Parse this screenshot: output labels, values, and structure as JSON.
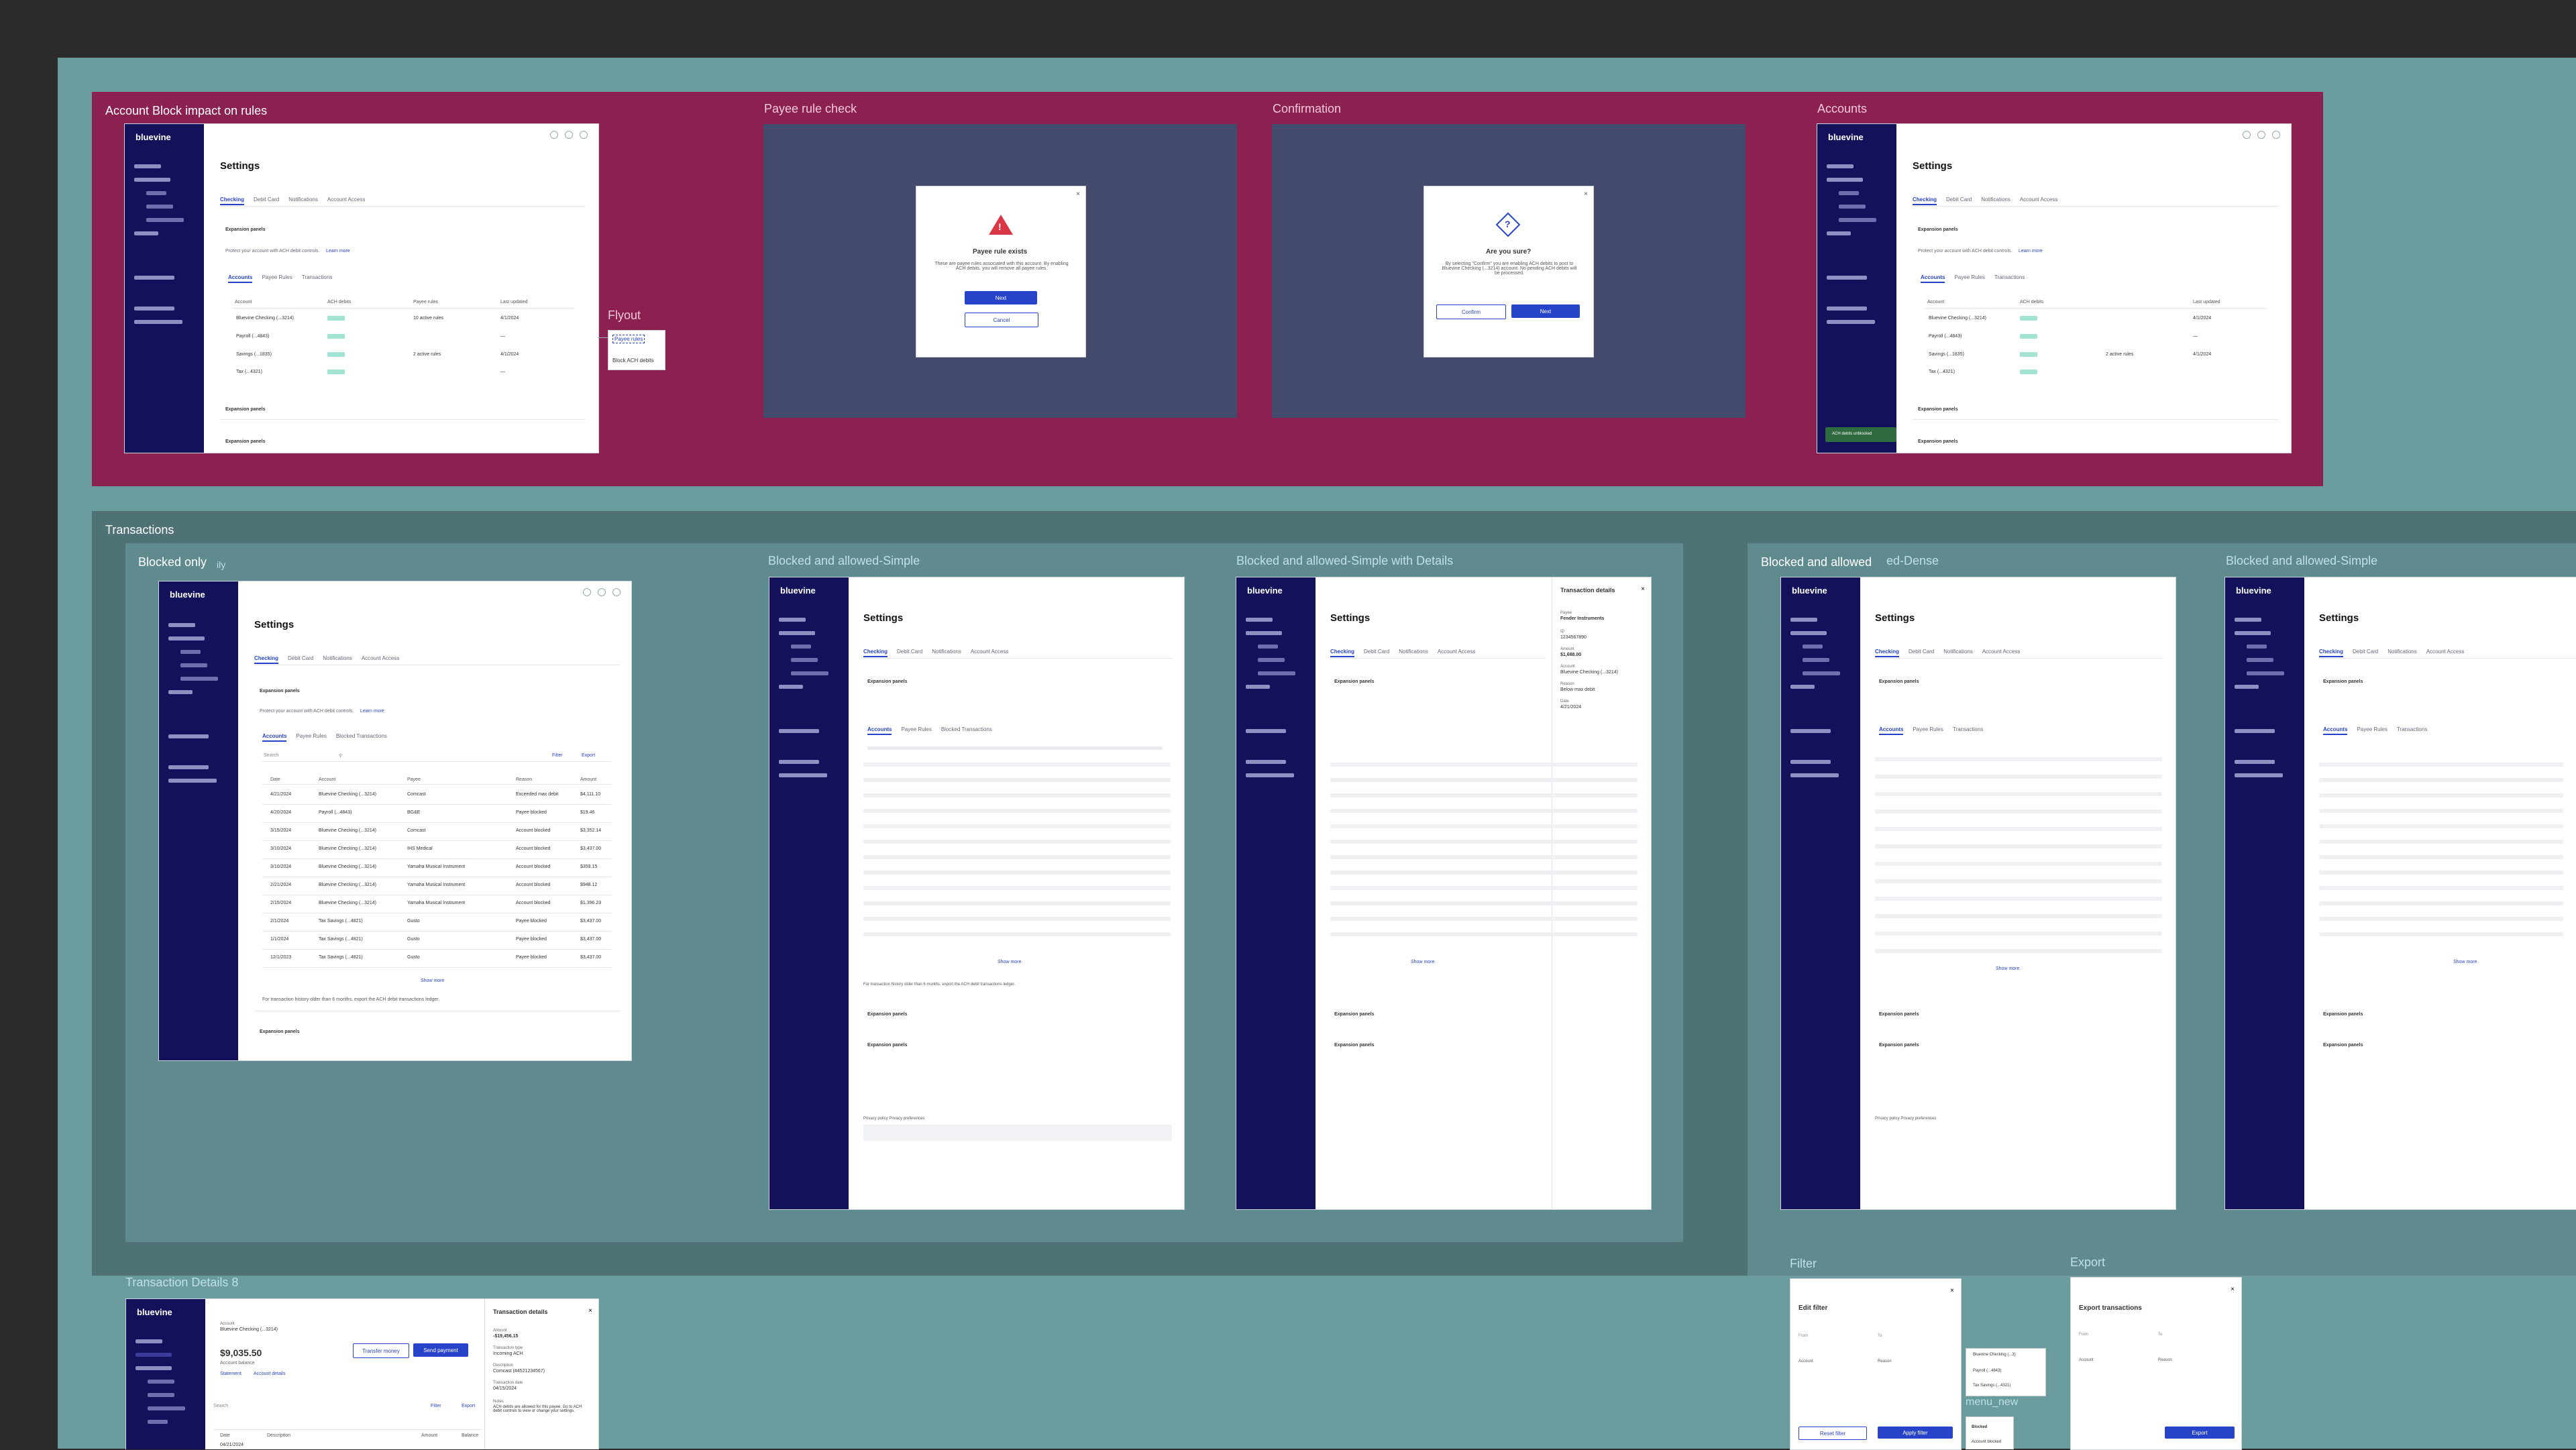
{
  "sections": {
    "account_block": "Account Block impact on rules",
    "payee_rule_check": "Payee rule check",
    "confirmation": "Confirmation",
    "accounts": "Accounts",
    "flyout": "Flyout",
    "transactions": "Transactions",
    "blocked_only": "Blocked only",
    "blocked_only_suffix": "ily",
    "blocked_allowed_simple": "Blocked and allowed-Simple",
    "blocked_allowed_simple_details": "Blocked and allowed-Simple with Details",
    "blocked_allowed": "Blocked and allowed",
    "blocked_allowed_suffix": "ed-Dense",
    "blocked_allowed_simple_2": "Blocked and allowed-Simple",
    "transaction_details_8": "Transaction Details 8",
    "filter": "Filter",
    "export": "Export",
    "menu_new": "menu_new"
  },
  "app": {
    "logo": "bluevine",
    "page_title": "Settings",
    "tabs": [
      "Checking",
      "Debit Card",
      "Notifications",
      "Account Access"
    ],
    "expansion_panels": "Expansion panels",
    "protect_text": "Protect your account with ACH debit controls.",
    "learn_more": "Learn more",
    "subtabs": [
      "Accounts",
      "Payee Rules",
      "Transactions"
    ],
    "subtabs_blocked": [
      "Accounts",
      "Payee Rules",
      "Blocked Transactions"
    ],
    "table_headers": [
      "Account",
      "ACH debits",
      "Payee rules",
      "Last updated"
    ],
    "accounts": [
      {
        "name": "Bluevine Checking (...3214)",
        "status": "Blocked",
        "rules": "10 active rules",
        "updated": "4/1/2024"
      },
      {
        "name": "Payroll (...4843)",
        "status": "Blocked",
        "rules": "",
        "updated": "—"
      },
      {
        "name": "Savings (...1835)",
        "status": "Blocked",
        "rules": "2 active rules",
        "updated": "4/1/2024"
      },
      {
        "name": "Tax (...4321)",
        "status": "Allowed",
        "rules": "",
        "updated": "—"
      }
    ],
    "flyout_items": [
      "Payee rules",
      "Block ACH debits"
    ],
    "toast": "ACH debits unblocked",
    "search": "Search",
    "filter": "Filter",
    "export": "Export",
    "txn_headers": [
      "Date",
      "Account",
      "Payee",
      "Reason",
      "Amount"
    ],
    "transactions": [
      {
        "date": "4/21/2024",
        "account": "Bluevine Checking (...3214)",
        "payee": "Comcast",
        "reason": "Exceeded max debit",
        "amount": "$4,111.10"
      },
      {
        "date": "4/20/2024",
        "account": "Payroll (...4843)",
        "payee": "BG&E",
        "reason": "Payee blocked",
        "amount": "$19.46"
      },
      {
        "date": "3/15/2024",
        "account": "Bluevine Checking (...3214)",
        "payee": "Comcast",
        "reason": "Account blocked",
        "amount": "$3,352.14"
      },
      {
        "date": "3/10/2024",
        "account": "Bluevine Checking (...3214)",
        "payee": "IHS Medical",
        "reason": "Account blocked",
        "amount": "$3,437.00"
      },
      {
        "date": "3/10/2024",
        "account": "Bluevine Checking (...3214)",
        "payee": "Yamaha Musical Instrument",
        "reason": "Account blocked",
        "amount": "$359.15"
      },
      {
        "date": "2/21/2024",
        "account": "Bluevine Checking (...3214)",
        "payee": "Yamaha Musical Instrument",
        "reason": "Account blocked",
        "amount": "$948.12"
      },
      {
        "date": "2/15/2024",
        "account": "Bluevine Checking (...3214)",
        "payee": "Yamaha Musical Instrument",
        "reason": "Account blocked",
        "amount": "$1,396.23"
      },
      {
        "date": "2/1/2024",
        "account": "Tax Savings (...4821)",
        "payee": "Gusto",
        "reason": "Payee blocked",
        "amount": "$3,437.00"
      },
      {
        "date": "1/1/2024",
        "account": "Tax Savings (...4821)",
        "payee": "Gusto",
        "reason": "Payee blocked",
        "amount": "$3,437.00"
      },
      {
        "date": "12/1/2023",
        "account": "Tax Savings (...4821)",
        "payee": "Gusto",
        "reason": "Payee blocked",
        "amount": "$3,437.00"
      }
    ],
    "show_more": "Show more",
    "history_note": "For transaction history older than 6 months, export the ACH debit transactions ledger.",
    "privacy": "Privacy policy   Privacy preferences"
  },
  "modals": {
    "payee_title": "Payee rule exists",
    "payee_body": "These are payee rules associated with this account. By enabling ACH debits, you will remove all payee rules.",
    "payee_primary": "Next",
    "payee_secondary": "Cancel",
    "confirm_title": "Are you sure?",
    "confirm_body": "By selecting \"Confirm\" you are enabling ACH debits to post to Bluevine Checking (...3214) account. No pending ACH debits will be processed.",
    "confirm_secondary": "Confirm",
    "confirm_primary": "Next"
  },
  "details": {
    "panel_title": "Transaction details",
    "payee_label": "Payee",
    "payee_value": "Fender Instruments",
    "id_label": "ID",
    "id_value": "1234567890",
    "amount_label": "Amount",
    "amount_value": "$1,688.00",
    "account_label": "Account",
    "account_value": "Bluevine Checking (...3214)",
    "reason_label": "Reason",
    "reason_value": "Below max debit",
    "date_label": "Date",
    "date_value": "4/21/2024"
  },
  "txn_details": {
    "account_label": "Account",
    "account_value": "Bluevine Checking (...3214)",
    "balance": "$9,035.50",
    "balance_label": "Account balance",
    "statement": "Statement",
    "account_details": "Account details",
    "transfer_money": "Transfer money",
    "send_payment": "Send payment",
    "panel_title": "Transaction details",
    "amount_label": "Amount",
    "amount_value": "-$19,456.15",
    "type_label": "Transaction type",
    "type_value": "Incoming ACH",
    "desc_label": "Description",
    "desc_value": "Comcast (#4521234567)",
    "date_label": "Transaction date",
    "date_value": "04/15/2024",
    "notes_label": "Notes",
    "notes_value": "ACH debits are allowed for this payee. Go to ACH debit controls to view or change your settings.",
    "headers": [
      "Date",
      "Description",
      "Amount",
      "Balance"
    ],
    "first_date": "04/21/2024"
  },
  "filter_panel": {
    "title": "Edit filter",
    "from": "From",
    "to": "To",
    "account": "Account",
    "reason": "Reason",
    "reset": "Reset filter",
    "apply": "Apply filter"
  },
  "export_panel": {
    "title": "Export transactions",
    "from": "From",
    "to": "To",
    "account": "Account",
    "reason": "Reason",
    "button": "Export"
  },
  "menu": {
    "items": [
      "Bluevine Checking (...3)",
      "Payroll (...4843)",
      "Tax Savings (...4321)"
    ],
    "blocked_label": "Blocked",
    "option": "Account blocked"
  },
  "colors": {
    "background": "#2b2b2b",
    "teal_region": "#6a9c9e",
    "slate_region": "#4f7277",
    "magenta_region": "#8b2150",
    "navy_sidebar": "#13115a",
    "primary_blue": "#2743c9"
  }
}
